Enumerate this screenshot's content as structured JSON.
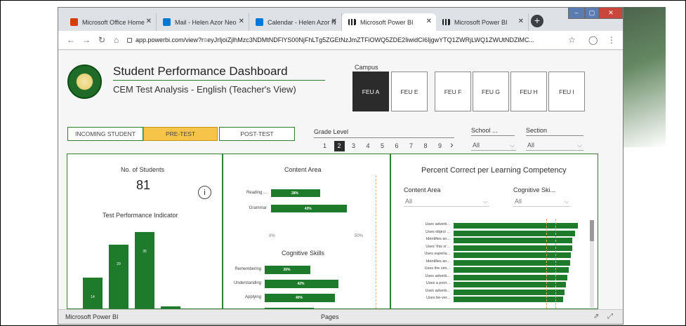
{
  "browser": {
    "tabs": [
      {
        "label": "Microsoft Office Home",
        "icon": "office-icon",
        "color": "#d83b01"
      },
      {
        "label": "Mail - Helen Azor Neo",
        "icon": "outlook-icon",
        "color": "#0078d4"
      },
      {
        "label": "Calendar - Helen Azor N",
        "icon": "calendar-icon",
        "color": "#0078d4"
      },
      {
        "label": "Microsoft Power BI",
        "icon": "powerbi-icon",
        "color": "#222222"
      },
      {
        "label": "Microsoft Power BI",
        "icon": "powerbi-icon",
        "color": "#222222"
      }
    ],
    "url": "app.powerbi.com/view?r=eyJrIjoiZjlhMzc3NDMtNDFlYS00NjFhLTg5ZGEtNzJmZTFiOWQ5ZDE2IiwidCI6IjgwYTQ1ZWRjLWQ1ZWUtNDZlMC..."
  },
  "report": {
    "title": "Student Performance Dashboard",
    "subtitle": "CEM Test Analysis - English (Teacher's View)",
    "campus_label": "Campus",
    "campuses": [
      "FEU A",
      "FEU E",
      "FEU F",
      "FEU G",
      "FEU H",
      "FEU I"
    ],
    "tests": [
      "INCOMING STUDENT",
      "PRE-TEST",
      "POST-TEST"
    ],
    "grade_label": "Grade Level",
    "grades": [
      "1",
      "2",
      "3",
      "4",
      "5",
      "6",
      "7",
      "8",
      "9"
    ],
    "school_label": "School ...",
    "school_value": "All",
    "section_label": "Section",
    "section_value": "All"
  },
  "panel1": {
    "students_label": "No. of Students",
    "students_value": "81",
    "indicator_label": "Test Performance Indicator"
  },
  "panel2": {
    "content_title": "Content Area",
    "cognitive_title": "Cognitive Skills",
    "axis_min": "0%",
    "axis_max": "50%"
  },
  "panel3": {
    "title": "Percent Correct per Learning Competency",
    "content_label": "Content Area",
    "content_value": "All",
    "cognitive_label": "Cognitive Ski...",
    "cognitive_value": "All"
  },
  "chart_data": [
    {
      "type": "bar",
      "title": "Test Performance Indicator",
      "categories": [
        "",
        "",
        "",
        ""
      ],
      "values": [
        14,
        29,
        35,
        1
      ],
      "data_labels": [
        "14",
        "29",
        "35",
        ""
      ]
    },
    {
      "type": "bar",
      "title": "Content Area",
      "categories": [
        "Reading ...",
        "Grammar"
      ],
      "values": [
        28,
        43
      ],
      "data_labels": [
        "28%",
        "43%"
      ],
      "xlim": [
        0,
        50
      ],
      "tick_labels": [
        "0%",
        "50%"
      ]
    },
    {
      "type": "bar",
      "title": "Cognitive Skills",
      "categories": [
        "Remembering",
        "Understanding",
        "Applying",
        ""
      ],
      "values": [
        26,
        42,
        40,
        28
      ],
      "data_labels": [
        "26%",
        "42%",
        "40%",
        ""
      ]
    },
    {
      "type": "bar",
      "title": "Percent Correct per Learning Competency",
      "categories": [
        "Uses adverb...",
        "Uses object ...",
        "Identifies an...",
        "Uses 'this is'...",
        "Uses superla...",
        "Identifies an...",
        "Uses the sim...",
        "Uses adverb...",
        "Uses a pron...",
        "Uses adverb...",
        "Uses be-ver..."
      ],
      "values": [
        96,
        94,
        92,
        92,
        91,
        90,
        89,
        88,
        87,
        86,
        85
      ],
      "xlim": [
        0,
        100
      ]
    }
  ],
  "footer": {
    "app_name": "Microsoft Power BI",
    "pages_label": "Pages"
  },
  "colors": {
    "accent": "#1e7b2c",
    "selected_test": "#f7c44a",
    "selected_campus": "#2b2b2b"
  }
}
